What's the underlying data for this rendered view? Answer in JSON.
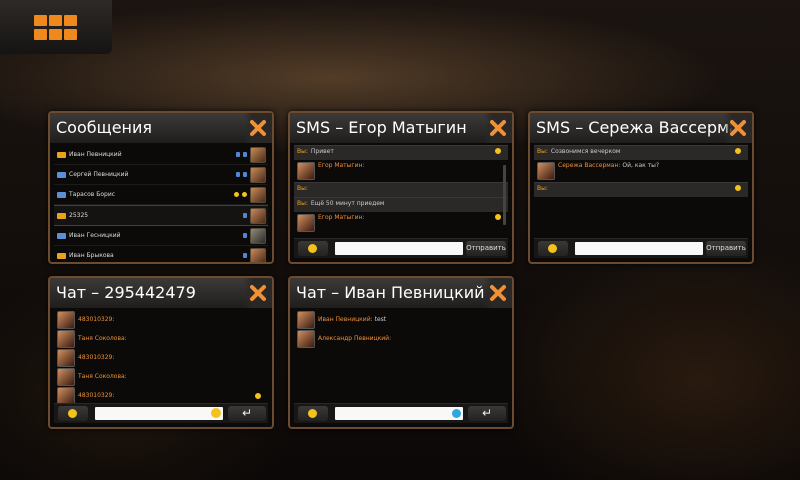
{
  "menu": {
    "icon": "grid-menu-icon",
    "accent": "#f0891d"
  },
  "windows": {
    "messages": {
      "title": "Сообщения",
      "rows": [
        {
          "name": "Иван Певницкий",
          "preview": ""
        },
        {
          "name": "Сергей Певницкий",
          "preview": ""
        },
        {
          "name": "Тарасов Борис",
          "preview": ""
        },
        {
          "name": "25325",
          "preview": ""
        },
        {
          "name": "Иван Гесницкий",
          "preview": ""
        },
        {
          "name": "Иван Брыкова",
          "preview": ""
        }
      ]
    },
    "sms1": {
      "title": "SMS – Егор Матыгин",
      "lines": [
        {
          "sender": "Вы:",
          "text": "Привет",
          "time": ""
        },
        {
          "sender": "Егор Матыгин:",
          "text": "",
          "time": ""
        },
        {
          "sender": "Вы:",
          "text": "",
          "time": ""
        },
        {
          "sender": "Вы:",
          "text": "Ещё 50 минут приедем",
          "time": ""
        },
        {
          "sender": "Егор Матыгин:",
          "text": "",
          "time": ""
        }
      ],
      "counter": "",
      "send_label": "Отправить"
    },
    "sms2": {
      "title": "SMS – Сережа Вассерман",
      "lines": [
        {
          "sender": "Вы:",
          "text": "Созвонимся вечерком",
          "time": ""
        },
        {
          "sender": "Сережа Вассерман:",
          "text": "Ой, как ты?",
          "time": ""
        },
        {
          "sender": "Вы:",
          "text": "",
          "time": ""
        }
      ],
      "counter": "",
      "send_label": "Отправить"
    },
    "chat1": {
      "title": "Чат – 295442479",
      "lines": [
        {
          "sender": "483010329:",
          "text": "",
          "time": ""
        },
        {
          "sender": "Таня Соколова:",
          "text": "",
          "time": ""
        },
        {
          "sender": "483010329:",
          "text": "",
          "time": ""
        },
        {
          "sender": "Таня Соколова:",
          "text": "",
          "time": ""
        },
        {
          "sender": "483010329:",
          "text": "",
          "time": ""
        }
      ],
      "enter_label": "↵"
    },
    "chat2": {
      "title": "Чат – Иван Певницкий",
      "lines": [
        {
          "sender": "Иван Певницкий:",
          "text": "test",
          "time": ""
        },
        {
          "sender": "Александр Певницкий:",
          "text": "",
          "time": ""
        }
      ],
      "enter_label": "↵"
    }
  }
}
